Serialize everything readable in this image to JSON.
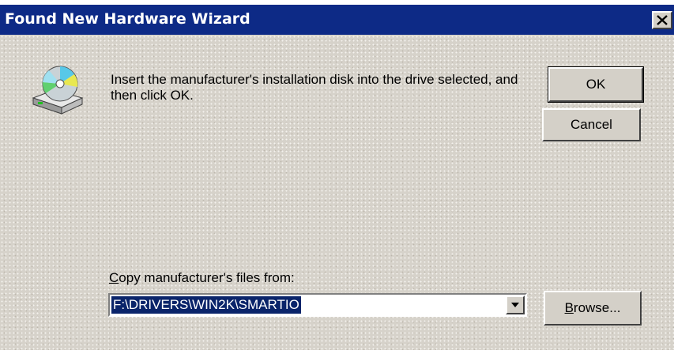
{
  "window": {
    "title": "Found New Hardware Wizard",
    "close_icon": "close-icon",
    "colors": {
      "titlebar": "#0d2a86",
      "face": "#d4d0c8",
      "selection": "#0a246a"
    }
  },
  "message": "Insert the manufacturer's installation disk into the drive selected, and then click OK.",
  "icon": "install-disk-icon",
  "buttons": {
    "ok": "OK",
    "cancel": "Cancel",
    "browse_mnemonic": "B",
    "browse_rest": "rowse..."
  },
  "copy_from": {
    "label_mnemonic": "C",
    "label_rest": "opy manufacturer's files from:",
    "value": "F:\\DRIVERS\\WIN2K\\SMARTIO",
    "dropdown_icon": "dropdown-arrow-icon"
  }
}
